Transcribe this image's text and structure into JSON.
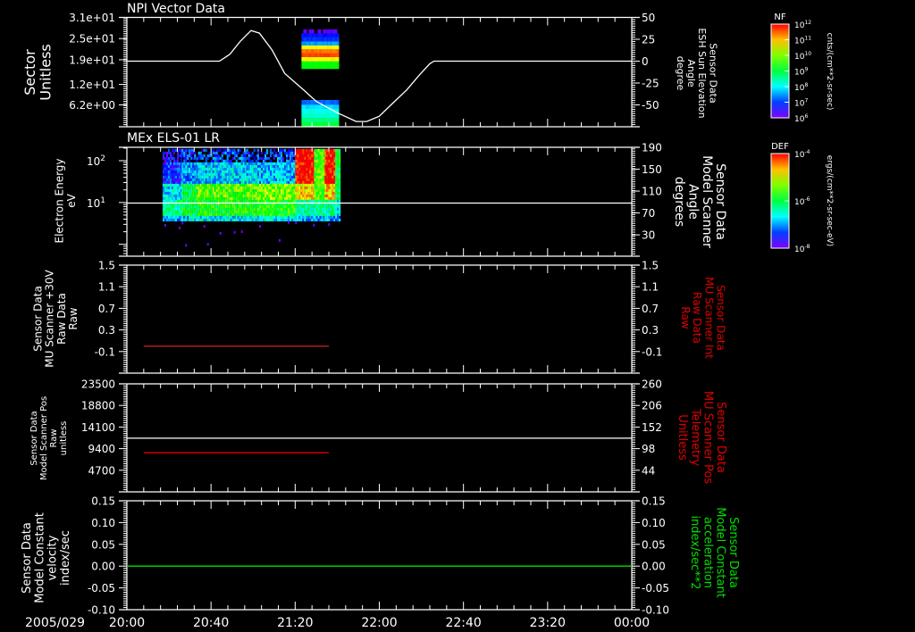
{
  "time_axis": {
    "date": "2005/029",
    "ticks": [
      "20:00",
      "20:40",
      "21:20",
      "22:00",
      "22:40",
      "23:20",
      "00:00"
    ]
  },
  "colorbars": [
    {
      "title": "NF",
      "base": "10",
      "exponents": [
        "12",
        "11",
        "10",
        "9",
        "8",
        "7",
        "6"
      ],
      "units": "cnts/(cm**2-sr-sec)"
    },
    {
      "title": "DEF",
      "base": "10",
      "exponents": [
        "-4",
        "-6",
        "-8"
      ],
      "units": "ergs/(cm**2-sr-sec-eV)"
    }
  ],
  "colors": {
    "background": "#000000",
    "axes": "#ffffff",
    "red": "#e00000",
    "green": "#00e000"
  },
  "chart_data": [
    {
      "type": "line",
      "title": "NPI Vector Data",
      "xlim": [
        "20:00",
        "00:00"
      ],
      "ylabel_left": [
        "Sector",
        "Unitless"
      ],
      "yticks_left": [
        "3.1e+01",
        "2.5e+01",
        "1.9e+01",
        "1.2e+01",
        "6.2e+00"
      ],
      "ylim_left": [
        0,
        31
      ],
      "ylabel_right": [
        "Sensor Data",
        "ESH Sun Elevation",
        "Angle",
        "degree"
      ],
      "ylabel_right_color": "#ffffff",
      "yticks_right": [
        "50",
        "25",
        "0",
        "-25",
        "-50"
      ],
      "ylim_right": [
        -75,
        50
      ],
      "series": [
        {
          "axis": "right",
          "color": "#ffffff",
          "points": [
            [
              "20:00",
              0
            ],
            [
              "20:44",
              0
            ],
            [
              "20:49",
              8
            ],
            [
              "20:54",
              23
            ],
            [
              "20:59",
              35
            ],
            [
              "21:03",
              32
            ],
            [
              "21:09",
              13
            ],
            [
              "21:15",
              -14
            ],
            [
              "21:24",
              -33
            ],
            [
              "21:30",
              -46
            ],
            [
              "21:40",
              -59
            ],
            [
              "21:49",
              -69
            ],
            [
              "21:54",
              -69
            ],
            [
              "22:00",
              -63
            ],
            [
              "22:06",
              -49
            ],
            [
              "22:13",
              -33
            ],
            [
              "22:19",
              -16
            ],
            [
              "22:24",
              -3
            ],
            [
              "22:26",
              0
            ],
            [
              "00:00",
              0
            ]
          ]
        }
      ],
      "spectrogram": {
        "colorbar": "NF",
        "start": "21:23",
        "end": "21:40",
        "sector_bins": [
          [
            0.0,
            1.3,
            0.5
          ],
          [
            1.3,
            2.5,
            0.45
          ],
          [
            2.5,
            3.8,
            0.38
          ],
          [
            3.8,
            5.1,
            0.35
          ],
          [
            5.1,
            6.3,
            0.3
          ],
          [
            6.3,
            7.6,
            0.2
          ],
          [
            16.4,
            17.5,
            0.55
          ],
          [
            17.5,
            18.6,
            0.55
          ],
          [
            18.6,
            19.8,
            0.78
          ],
          [
            19.8,
            20.9,
            0.95
          ],
          [
            20.9,
            22.0,
            0.9
          ],
          [
            22.0,
            23.1,
            0.78
          ],
          [
            23.1,
            24.2,
            0.25
          ],
          [
            24.2,
            25.4,
            0.15
          ],
          [
            25.4,
            26.5,
            0.12
          ],
          [
            26.5,
            27.6,
            0.03
          ]
        ]
      }
    },
    {
      "type": "heatmap",
      "title": "MEx ELS-01 LR",
      "xlim": [
        "20:00",
        "00:00"
      ],
      "ylabel_left": [
        "Electron Energy",
        "eV"
      ],
      "yticks_left_exponents": [
        "2",
        "1"
      ],
      "ytick_base": "10",
      "ylim_left": [
        0.52,
        209
      ],
      "yscale_left": "log",
      "ylabel_right": [
        "Sensor Data",
        "Model Scanner",
        "Angle",
        "degrees"
      ],
      "ylabel_right_color": "#ffffff",
      "yticks_right": [
        "190",
        "150",
        "110",
        "70",
        "30"
      ],
      "ylim_right": [
        -9,
        190
      ],
      "series": [
        {
          "axis": "right",
          "color": "#ffffff",
          "points": [
            [
              "20:00",
              88
            ],
            [
              "00:00",
              88
            ]
          ]
        }
      ],
      "spectrogram": {
        "colorbar": "DEF",
        "energy_range_eV": [
          4,
          190
        ],
        "band_edges_eV": [
          4,
          12,
          30,
          190
        ],
        "segments": [
          {
            "start": "20:17",
            "end": "20:26",
            "low": 0.42,
            "mid": 0.32,
            "high": 0.14
          },
          {
            "start": "20:26",
            "end": "20:33",
            "low": 0.5,
            "mid": 0.5,
            "high": 0.25
          },
          {
            "start": "20:33",
            "end": "21:02",
            "low": 0.55,
            "mid": 0.62,
            "high": 0.3
          },
          {
            "start": "21:02",
            "end": "21:20",
            "low": 0.56,
            "mid": 0.66,
            "high": 0.28
          },
          {
            "start": "21:20",
            "end": "21:29",
            "low": 0.42,
            "mid": 0.8,
            "high": 1.0
          },
          {
            "start": "21:29",
            "end": "21:34",
            "low": 0.42,
            "mid": 0.6,
            "high": 0.62
          },
          {
            "start": "21:34",
            "end": "21:39",
            "low": 0.42,
            "mid": 0.82,
            "high": 1.0
          },
          {
            "start": "21:39",
            "end": "21:41",
            "low": 0.35,
            "mid": 0.5,
            "high": 0.5
          }
        ]
      }
    },
    {
      "type": "line",
      "xlim": [
        "20:00",
        "00:00"
      ],
      "ylabel_left": [
        "Sensor Data",
        "MU Scanner +30V",
        "Raw Data",
        "Raw"
      ],
      "yticks_left": [
        "1.5",
        "1.1",
        "0.7",
        "0.3",
        "-0.1"
      ],
      "ylim_left": [
        -0.5,
        1.5
      ],
      "ylabel_right": [
        "Sensor Data",
        "MU Scanner Int",
        "Raw Data",
        "Raw"
      ],
      "ylabel_right_color": "#e00000",
      "yticks_right": [
        "1.5",
        "1.1",
        "0.7",
        "0.3",
        "-0.1"
      ],
      "ylim_right": [
        -0.5,
        1.5
      ],
      "series": [
        {
          "axis": "left",
          "color": "#c02020",
          "points": [
            [
              "20:08",
              0
            ],
            [
              "21:36",
              0
            ]
          ]
        }
      ]
    },
    {
      "type": "line",
      "xlim": [
        "20:00",
        "00:00"
      ],
      "ylabel_left": [
        "Sensor Data",
        "Model Scanner Pos",
        "Raw",
        "unitless"
      ],
      "yticks_left": [
        "23500",
        "18800",
        "14100",
        "9400",
        "4700"
      ],
      "ylim_left": [
        0,
        23500
      ],
      "ylabel_right": [
        "Sensor Data",
        "MU Scanner Pos",
        "Telemetry",
        "Unitless"
      ],
      "ylabel_right_color": "#e00000",
      "yticks_right": [
        "260",
        "206",
        "152",
        "98",
        "44"
      ],
      "ylim_right": [
        -10,
        260
      ],
      "series": [
        {
          "axis": "left",
          "color": "#e00000",
          "points": [
            [
              "20:08",
              8500
            ],
            [
              "21:36",
              8500
            ]
          ]
        },
        {
          "axis": "right",
          "color": "#ffffff",
          "points": [
            [
              "20:00",
              124
            ],
            [
              "00:00",
              124
            ]
          ]
        }
      ]
    },
    {
      "type": "line",
      "xlim": [
        "20:00",
        "00:00"
      ],
      "ylabel_left": [
        "Sensor Data",
        "Model Constant",
        "velocity",
        "index/sec"
      ],
      "yticks_left": [
        "0.15",
        "0.10",
        "0.05",
        "0.00",
        "-0.05",
        "-0.10"
      ],
      "ylim_left": [
        -0.1,
        0.15
      ],
      "ylabel_right": [
        "Sensor Data",
        "Model Constant",
        "acceleration",
        "index/sec**2"
      ],
      "ylabel_right_color": "#00e000",
      "yticks_right": [
        "0.15",
        "0.10",
        "0.05",
        "0.00",
        "-0.05",
        "-0.10"
      ],
      "ylim_right": [
        -0.1,
        0.15
      ],
      "series": [
        {
          "axis": "right",
          "color": "#00e000",
          "points": [
            [
              "20:00",
              0
            ],
            [
              "00:00",
              0
            ]
          ]
        }
      ]
    }
  ]
}
